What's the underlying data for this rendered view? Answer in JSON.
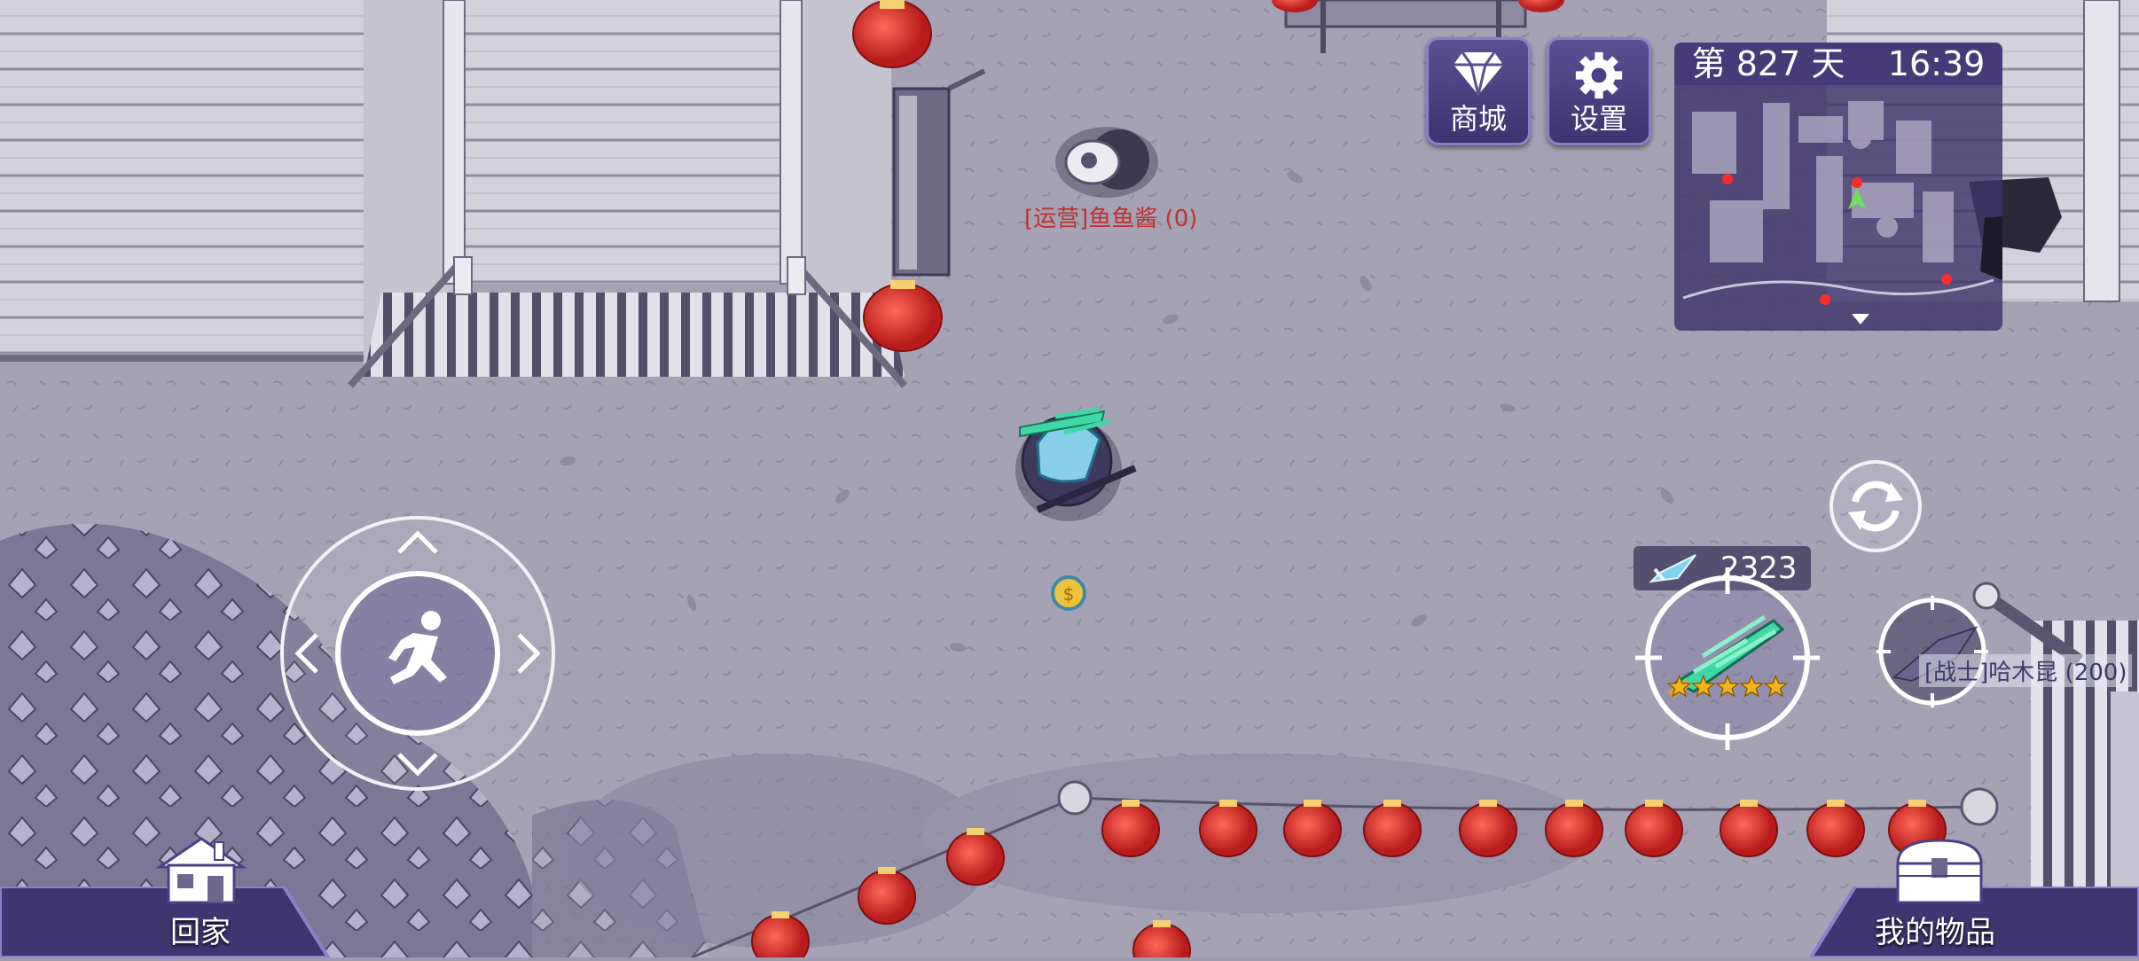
{
  "hud": {
    "shop_label": "商城",
    "settings_label": "设置",
    "home_label": "回家",
    "inventory_label": "我的物品"
  },
  "minimap": {
    "day_text": "第 827 天",
    "time": "16:39"
  },
  "npc": {
    "name": "[运营]鱼鱼酱 (0)"
  },
  "enemy": {
    "name": "[战士]哈木昆 (200)"
  },
  "weapon": {
    "count": "2323",
    "stars": 5
  },
  "colors": {
    "hud_purple": "#4b3f86",
    "lantern_red": "#d42a2a",
    "npc_name_red": "#c0302c",
    "enemy_name": "#3b3a6b",
    "weapon_green": "#3fd7a6",
    "star_gold": "#f2b21c"
  },
  "icons": [
    "diamond-icon",
    "gear-icon",
    "run-icon",
    "refresh-icon",
    "house-icon",
    "chest-icon",
    "sword-icon",
    "star-icon",
    "coin-icon"
  ]
}
